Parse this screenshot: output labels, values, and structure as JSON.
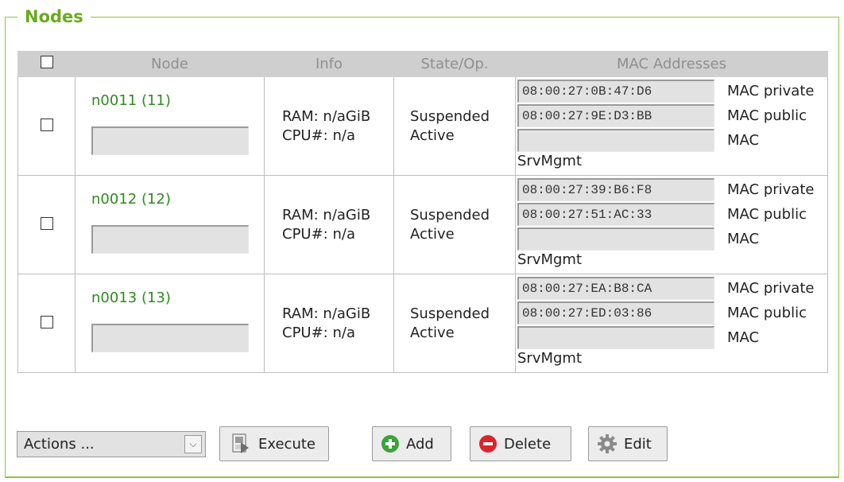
{
  "panel": {
    "title": "Nodes"
  },
  "table": {
    "headers": {
      "node": "Node",
      "info": "Info",
      "state": "State/Op.",
      "mac": "MAC Addresses"
    },
    "rows": [
      {
        "node_label": "n0011 (11)",
        "ram": "RAM: n/aGiB",
        "cpu": "CPU#: n/a",
        "state": "Suspended",
        "op": "Active",
        "macs": [
          {
            "value": "08:00:27:0B:47:D6",
            "label": "MAC private"
          },
          {
            "value": "08:00:27:9E:D3:BB",
            "label": "MAC public"
          },
          {
            "value": "",
            "label": "MAC"
          }
        ],
        "mac_extra_label": "SrvMgmt"
      },
      {
        "node_label": "n0012 (12)",
        "ram": "RAM: n/aGiB",
        "cpu": "CPU#: n/a",
        "state": "Suspended",
        "op": "Active",
        "macs": [
          {
            "value": "08:00:27:39:B6:F8",
            "label": "MAC private"
          },
          {
            "value": "08:00:27:51:AC:33",
            "label": "MAC public"
          },
          {
            "value": "",
            "label": "MAC"
          }
        ],
        "mac_extra_label": "SrvMgmt"
      },
      {
        "node_label": "n0013 (13)",
        "ram": "RAM: n/aGiB",
        "cpu": "CPU#: n/a",
        "state": "Suspended",
        "op": "Active",
        "macs": [
          {
            "value": "08:00:27:EA:B8:CA",
            "label": "MAC private"
          },
          {
            "value": "08:00:27:ED:03:86",
            "label": "MAC public"
          },
          {
            "value": "",
            "label": "MAC"
          }
        ],
        "mac_extra_label": "SrvMgmt"
      }
    ]
  },
  "toolbar": {
    "actions_select": "Actions ...",
    "execute_label": "Execute",
    "add_label": "Add",
    "delete_label": "Delete",
    "edit_label": "Edit"
  },
  "colors": {
    "accent": "#6aaa1e",
    "header_bg": "#cfcfcf"
  }
}
